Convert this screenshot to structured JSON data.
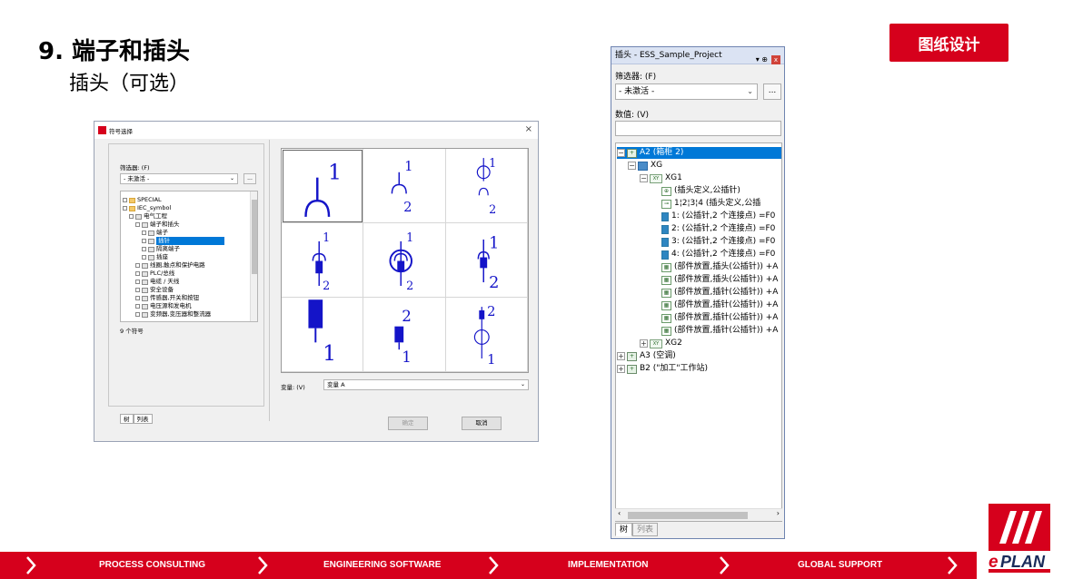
{
  "slide": {
    "title": "9. 端子和插头",
    "subtitle": "插头（可选）",
    "badge": "图纸设计"
  },
  "dialog": {
    "title": "符号选择",
    "close": "×",
    "filter_label": "筛选器: (F)",
    "filter_value": "- 未激活 -",
    "dots": "...",
    "tree": [
      {
        "label": "SPECIAL"
      },
      {
        "label": "IEC_symbol"
      },
      {
        "label": "电气工程"
      },
      {
        "label": "端子和插头"
      },
      {
        "label": "端子"
      },
      {
        "label": "插针"
      },
      {
        "label": "隔离端子"
      },
      {
        "label": "插座"
      },
      {
        "label": "线圈,触点和保护电路"
      },
      {
        "label": "PLC/总线"
      },
      {
        "label": "电缆 / 天线"
      },
      {
        "label": "安全设备"
      },
      {
        "label": "传感器,开关和按钮"
      },
      {
        "label": "电压源和发电机"
      },
      {
        "label": "变频器,变压器和整流器"
      }
    ],
    "count": "9 个符号",
    "tabs": [
      "树",
      "列表"
    ],
    "variant_label": "变量: (V)",
    "variant_value": "变量 A",
    "ok": "确定",
    "cancel": "取消",
    "symbol_labels": {
      "s1_top": "1",
      "s2_top": "1",
      "s2_bottom": "2",
      "s3_top": "1",
      "s3_bottom": "2",
      "s4_top": "1",
      "s4_bottom": "2",
      "s5_top": "1",
      "s5_bottom": "2",
      "s6_top": "1",
      "s6_bottom": "2",
      "s7_bottom": "1",
      "s8_top": "2",
      "s8_bottom": "1",
      "s9_top": "2",
      "s9_bottom": "1"
    },
    "accent_color": "#1414c8"
  },
  "navigator": {
    "title": "插头 - ESS_Sample_Project",
    "pin_glyph": "▾ ⊕",
    "close": "x",
    "filter_label": "筛选器: (F)",
    "filter_value": "- 未激活 -",
    "dots": "...",
    "value_label": "数值: (V)",
    "tree": [
      {
        "label": "A2 (箱柜 2)"
      },
      {
        "label": "XG"
      },
      {
        "label": "XG1"
      },
      {
        "label": "(插头定义,公插针)"
      },
      {
        "label": "1¦2¦3¦4 (插头定义,公插"
      },
      {
        "label": "1: (公插针,2 个连接点) =F0"
      },
      {
        "label": "2: (公插针,2 个连接点) =F0"
      },
      {
        "label": "3: (公插针,2 个连接点) =F0"
      },
      {
        "label": "4: (公插针,2 个连接点) =F0"
      },
      {
        "label": "(部件放置,插头(公插针)) +A"
      },
      {
        "label": "(部件放置,插头(公插针)) +A"
      },
      {
        "label": "(部件放置,插针(公插针)) +A"
      },
      {
        "label": "(部件放置,插针(公插针)) +A"
      },
      {
        "label": "(部件放置,插针(公插针)) +A"
      },
      {
        "label": "(部件放置,插针(公插针)) +A"
      },
      {
        "label": "XG2"
      },
      {
        "label": "A3 (空调)"
      },
      {
        "label": "B2 (\"加工\"工作站)"
      }
    ],
    "tabs": [
      "树",
      "列表"
    ]
  },
  "footer": {
    "items": [
      "PROCESS CONSULTING",
      "ENGINEERING SOFTWARE",
      "IMPLEMENTATION",
      "GLOBAL SUPPORT"
    ],
    "color": "#d6001c"
  },
  "logo": {
    "text": "PLAN",
    "mark": "e"
  }
}
